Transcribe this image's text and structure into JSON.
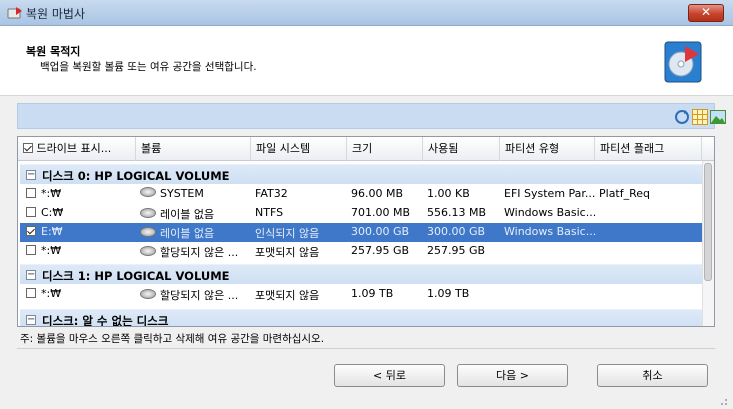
{
  "window": {
    "title": "복원 마법사",
    "close_label": "✕"
  },
  "header": {
    "title": "복원 목적지",
    "subtitle": "백업을 복원할 볼륨 또는 여유 공간을 선택합니다."
  },
  "toolbar": {
    "icons": [
      "refresh-icon",
      "grid-view-icon",
      "image-view-icon"
    ]
  },
  "table": {
    "columns": [
      "드라이브 표시...",
      "볼륨",
      "파일 시스템",
      "크기",
      "사용됨",
      "파티션 유형",
      "파티션 플래그"
    ],
    "header_checked": true,
    "groups": [
      {
        "label": "디스크 0: HP LOGICAL VOLUME",
        "rows": [
          {
            "checked": false,
            "drive": "*:₩",
            "volume": "SYSTEM",
            "fs": "FAT32",
            "size": "96.00 MB",
            "used": "1.00 KB",
            "ptype": "EFI System Par...",
            "pflag": "Platf_Req",
            "selected": false
          },
          {
            "checked": false,
            "drive": "C:₩",
            "volume": "레이블 없음",
            "fs": "NTFS",
            "size": "701.00 MB",
            "used": "556.13 MB",
            "ptype": "Windows Basic...",
            "pflag": "",
            "selected": false
          },
          {
            "checked": true,
            "drive": "E:₩",
            "volume": "레이블 없음",
            "fs": "인식되지 않음",
            "size": "300.00 GB",
            "used": "300.00 GB",
            "ptype": "Windows Basic...",
            "pflag": "",
            "selected": true
          },
          {
            "checked": false,
            "drive": "*:₩",
            "volume": "할당되지 않은 ...",
            "fs": "포맷되지 않음",
            "size": "257.95 GB",
            "used": "257.95 GB",
            "ptype": "",
            "pflag": "",
            "selected": false
          }
        ]
      },
      {
        "label": "디스크 1: HP LOGICAL VOLUME",
        "rows": [
          {
            "checked": false,
            "drive": "*:₩",
            "volume": "할당되지 않은 ...",
            "fs": "포맷되지 않음",
            "size": "1.09 TB",
            "used": "1.09 TB",
            "ptype": "",
            "pflag": "",
            "selected": false
          }
        ]
      },
      {
        "label": "디스크: 알 수 없는 디스크",
        "rows": []
      }
    ]
  },
  "note": "주: 볼륨을 마우스 오른쪽 클릭하고 삭제해 여유 공간을 마련하십시오.",
  "buttons": {
    "back": "< 뒤로",
    "next": "다음 >",
    "cancel": "취소"
  }
}
